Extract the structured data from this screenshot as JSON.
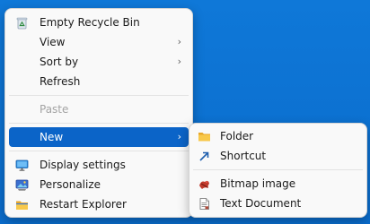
{
  "context_menu": {
    "items": [
      {
        "label": "Empty Recycle Bin",
        "icon": "recycle-bin-icon"
      },
      {
        "label": "View",
        "has_submenu": true
      },
      {
        "label": "Sort by",
        "has_submenu": true
      },
      {
        "label": "Refresh"
      },
      {
        "label": "Paste",
        "disabled": true
      },
      {
        "label": "New",
        "has_submenu": true,
        "selected": true
      },
      {
        "label": "Display settings",
        "icon": "display-settings-icon"
      },
      {
        "label": "Personalize",
        "icon": "personalize-icon"
      },
      {
        "label": "Restart Explorer",
        "icon": "restart-explorer-icon"
      }
    ]
  },
  "submenu_new": {
    "items": [
      {
        "label": "Folder",
        "icon": "folder-icon"
      },
      {
        "label": "Shortcut",
        "icon": "shortcut-arrow-icon"
      },
      {
        "label": "Bitmap image",
        "icon": "bitmap-image-icon"
      },
      {
        "label": "Text Document",
        "icon": "text-document-icon"
      }
    ]
  },
  "colors": {
    "desktop_background": "#0b72d3",
    "selection": "#0b64c8",
    "menu_background": "#f9f9f9",
    "disabled_text": "#a3a3a3"
  }
}
